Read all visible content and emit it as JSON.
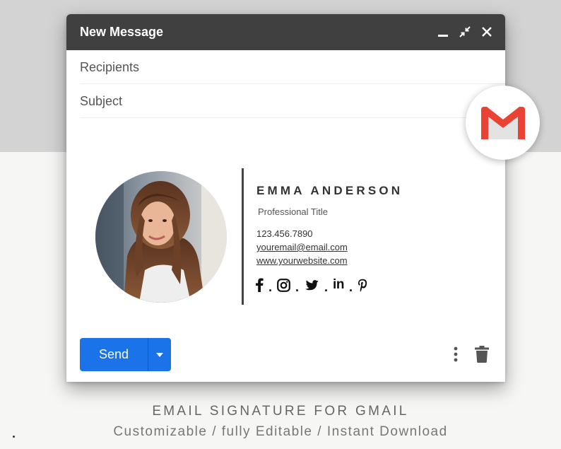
{
  "window": {
    "title": "New Message",
    "recipients_placeholder": "Recipients",
    "subject_placeholder": "Subject"
  },
  "signature": {
    "name": "EMMA ANDERSON",
    "title": "Professional Title",
    "phone": "123.456.7890",
    "email": "youremail@email.com",
    "website": "www.yourwebsite.com",
    "social": [
      "facebook-icon",
      "instagram-icon",
      "twitter-icon",
      "linkedin-icon",
      "pinterest-icon"
    ],
    "linkedin_text": "in"
  },
  "toolbar": {
    "send_label": "Send"
  },
  "caption": {
    "line1": "EMAIL SIGNATURE FOR GMAIL",
    "line2": "Customizable / fully Editable / Instant Download"
  },
  "colors": {
    "titlebar": "#404040",
    "send_blue": "#1a73e8",
    "gmail_red": "#ea4335"
  }
}
